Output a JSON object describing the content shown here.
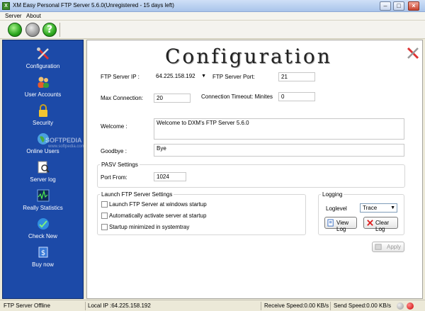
{
  "window": {
    "title": "XM Easy Personal FTP Server 5.6.0(Unregistered - 15 days left)"
  },
  "menu": {
    "server": "Server",
    "about": "About"
  },
  "sidebar": {
    "items": [
      {
        "label": "Configuration",
        "icon": "tools-icon"
      },
      {
        "label": "User Accounts",
        "icon": "users-icon"
      },
      {
        "label": "Security",
        "icon": "lock-icon"
      },
      {
        "label": "Online Users",
        "icon": "globe-icon"
      },
      {
        "label": "Server log",
        "icon": "log-magnifier-icon"
      },
      {
        "label": "Really Statistics",
        "icon": "statistics-icon"
      },
      {
        "label": "Check New",
        "icon": "check-new-icon"
      },
      {
        "label": "Buy now",
        "icon": "buy-icon"
      }
    ],
    "watermark": "SOFTPEDIA",
    "watermark_url": "www.softpedia.com"
  },
  "config": {
    "heading": "Configuration",
    "ftp_server_ip_label": "FTP Server  IP :",
    "ftp_server_ip_value": "64.225.158.192",
    "ftp_server_port_label": "FTP Server Port:",
    "ftp_server_port_value": "21",
    "max_connection_label": "Max Connection:",
    "max_connection_value": "20",
    "timeout_label": "Connection Timeout: Minites",
    "timeout_value": "0",
    "welcome_label": "Welcome :",
    "welcome_value": "Welcome to DXM's FTP Server 5.6.0",
    "goodbye_label": "Goodbye :",
    "goodbye_value": "Bye",
    "pasv": {
      "title": "PASV Settings",
      "port_from_label": "Port From:",
      "port_from_value": "1024"
    },
    "launch": {
      "title": "Launch FTP Server Settings",
      "opt1": "Launch FTP Server at windows startup",
      "opt2": "Automatically activate server at startup",
      "opt3": "Startup minimized in systemtray"
    },
    "logging": {
      "title": "Logging",
      "loglevel_label": "Loglevel",
      "loglevel_value": "Trace",
      "view_log": "View Log",
      "clear_log": "Clear Log"
    },
    "apply": "Apply"
  },
  "status": {
    "server_state": "FTP Server Offline",
    "local_ip": "Local IP :64.225.158.192",
    "receive_speed": "Receive Speed:0.00  KB/s",
    "send_speed": "Send Speed:0.00  KB/s"
  }
}
